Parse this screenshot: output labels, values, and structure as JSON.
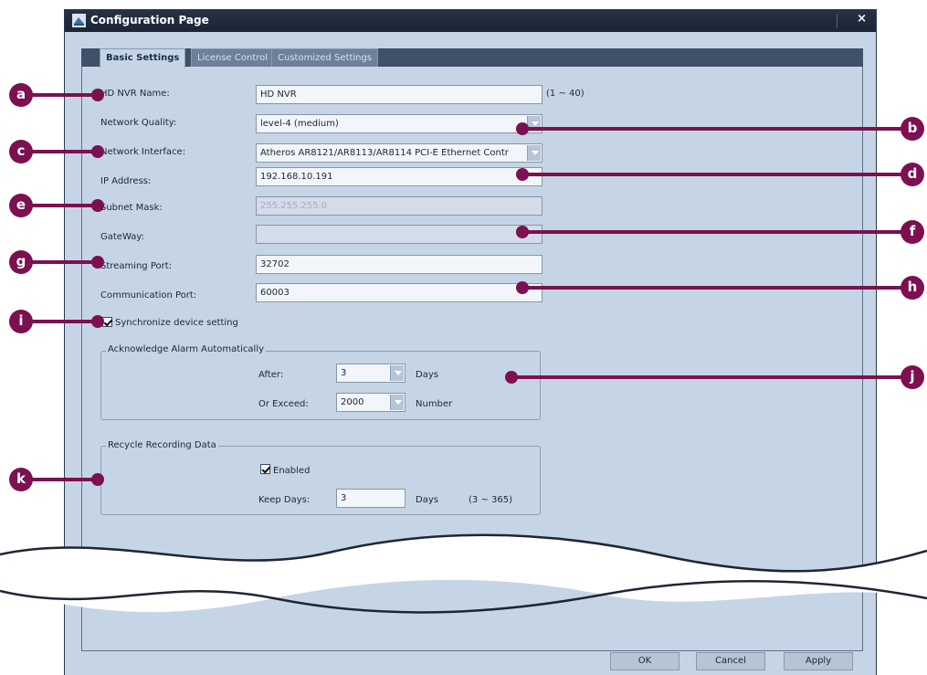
{
  "window": {
    "title": "Configuration Page",
    "close_label": "×"
  },
  "tabs": [
    {
      "label": "Basic Settings",
      "active": true
    },
    {
      "label": "License Control",
      "active": false
    },
    {
      "label": "Customized Settings",
      "active": false
    }
  ],
  "form": {
    "nvr_name": {
      "label": "HD NVR Name:",
      "value": "HD NVR",
      "range": "(1 ~ 40)"
    },
    "network_quality": {
      "label": "Network Quality:",
      "value": "level-4 (medium)"
    },
    "network_interface": {
      "label": "Network Interface:",
      "value": "Atheros AR8121/AR8113/AR8114 PCI-E Ethernet Contr"
    },
    "ip_address": {
      "label": "IP Address:",
      "value": "192.168.10.191"
    },
    "subnet_mask": {
      "label": "Subnet Mask:",
      "value": "255.255.255.0"
    },
    "gateway": {
      "label": "GateWay:",
      "value": ""
    },
    "streaming_port": {
      "label": "Streaming Port:",
      "value": "32702"
    },
    "communication_port": {
      "label": "Communication Port:",
      "value": "60003"
    },
    "sync_device": {
      "label": "Synchronize device setting",
      "checked": true
    }
  },
  "alarm_group": {
    "title": "Acknowledge Alarm Automatically",
    "after_label": "After:",
    "after_value": "3",
    "after_unit": "Days",
    "exceed_label": "Or Exceed:",
    "exceed_value": "2000",
    "exceed_unit": "Number"
  },
  "recycle_group": {
    "title": "Recycle Recording Data",
    "enabled_label": "Enabled",
    "enabled_checked": true,
    "keep_days_label": "Keep Days:",
    "keep_days_value": "3",
    "keep_days_unit": "Days",
    "keep_days_range": "(3 ~ 365)"
  },
  "buttons": {
    "ok": "OK",
    "cancel": "Cancel",
    "apply": "Apply"
  },
  "callouts": {
    "a": "a",
    "b": "b",
    "c": "c",
    "d": "d",
    "e": "e",
    "f": "f",
    "g": "g",
    "h": "h",
    "i": "i",
    "j": "j",
    "k": "k"
  },
  "colors": {
    "callout": "#7c1050",
    "window_bg": "#c5d5e6",
    "titlebar": "#1a2434"
  }
}
